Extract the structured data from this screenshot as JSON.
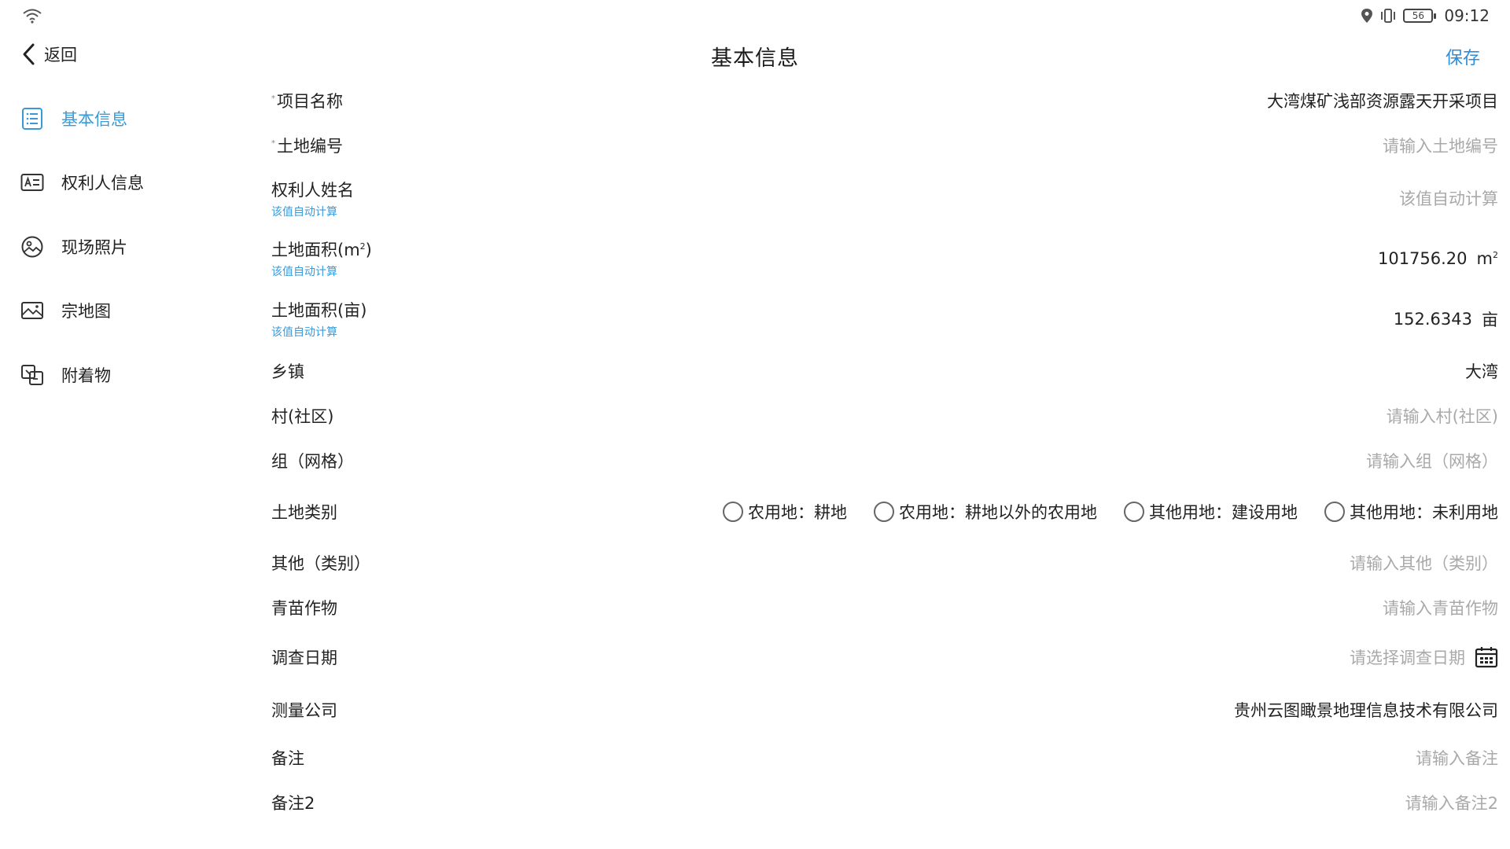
{
  "status_bar": {
    "time": "09:12",
    "battery": "56",
    "icons": [
      "wifi-icon",
      "location-icon",
      "vibrate-icon",
      "battery-icon"
    ]
  },
  "header": {
    "back_label": "返回",
    "title": "基本信息",
    "save_label": "保存"
  },
  "sidebar": {
    "items": [
      {
        "label": "基本信息",
        "icon": "list-icon",
        "active": true
      },
      {
        "label": "权利人信息",
        "icon": "id-card-icon",
        "active": false
      },
      {
        "label": "现场照片",
        "icon": "photo-icon",
        "active": false
      },
      {
        "label": "宗地图",
        "icon": "image-icon",
        "active": false
      },
      {
        "label": "附着物",
        "icon": "attachment-icon",
        "active": false
      }
    ]
  },
  "form": {
    "project_name": {
      "label": "项目名称",
      "required": true,
      "value": "大湾煤矿浅部资源露天开采项目"
    },
    "land_no": {
      "label": "土地编号",
      "required": true,
      "placeholder": "请输入土地编号"
    },
    "owner_name": {
      "label": "权利人姓名",
      "hint": "该值自动计算",
      "placeholder": "该值自动计算"
    },
    "area_m2": {
      "label": "土地面积(m",
      "label_sup": "2",
      "label_tail": ")",
      "hint": "该值自动计算",
      "value": "101756.20",
      "unit": "m",
      "unit_sup": "2"
    },
    "area_mu": {
      "label": "土地面积(亩)",
      "hint": "该值自动计算",
      "value": "152.6343",
      "unit": "亩"
    },
    "town": {
      "label": "乡镇",
      "value": "大湾"
    },
    "village": {
      "label": "村(社区)",
      "placeholder": "请输入村(社区)"
    },
    "group": {
      "label": "组（网格）",
      "placeholder": "请输入组（网格）"
    },
    "land_type": {
      "label": "土地类别",
      "options": [
        "农用地：耕地",
        "农用地：耕地以外的农用地",
        "其他用地：建设用地",
        "其他用地：未利用地"
      ]
    },
    "other_type": {
      "label": "其他（类别）",
      "placeholder": "请输入其他（类别）"
    },
    "crops": {
      "label": "青苗作物",
      "placeholder": "请输入青苗作物"
    },
    "survey_date": {
      "label": "调查日期",
      "placeholder": "请选择调查日期"
    },
    "survey_company": {
      "label": "测量公司",
      "value": "贵州云图瞰景地理信息技术有限公司"
    },
    "remark": {
      "label": "备注",
      "placeholder": "请输入备注"
    },
    "remark2": {
      "label": "备注2",
      "placeholder": "请输入备注2"
    }
  }
}
